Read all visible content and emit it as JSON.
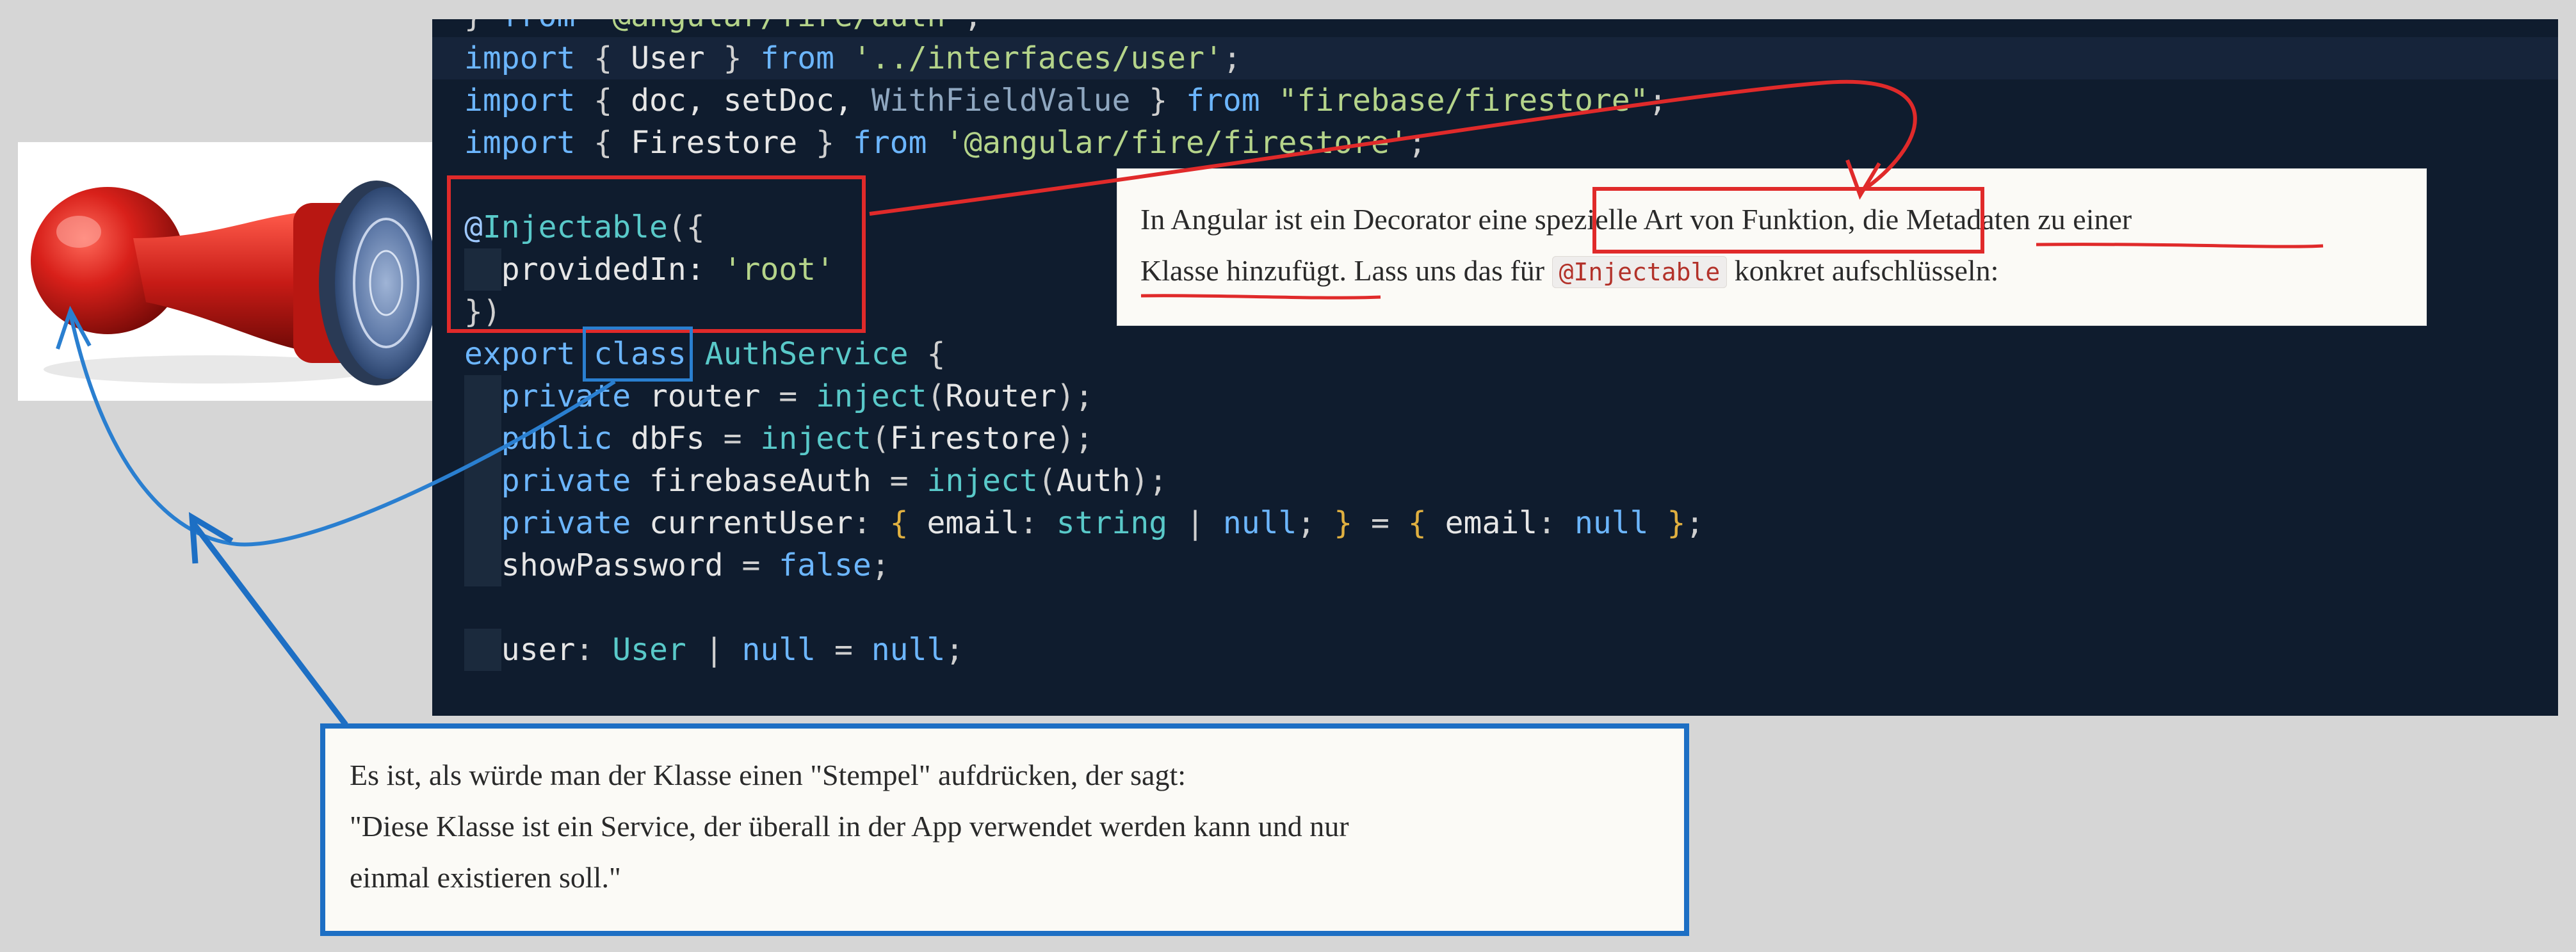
{
  "editor": {
    "lines": [
      {
        "id": "top-cut",
        "parts": [
          [
            "pun",
            "} "
          ],
          [
            "kw",
            "from "
          ],
          [
            "str",
            "\"@angular/fire/auth\""
          ],
          [
            "pun",
            ";"
          ]
        ]
      },
      {
        "id": "import-user",
        "parts": [
          [
            "kw",
            "import "
          ],
          [
            "pun",
            "{ "
          ],
          [
            "",
            "User "
          ],
          [
            "pun",
            "} "
          ],
          [
            "kw",
            "from "
          ],
          [
            "str",
            "'../interfaces/user'"
          ],
          [
            "pun",
            ";"
          ]
        ]
      },
      {
        "id": "import-firestore-fns",
        "parts": [
          [
            "kw",
            "import "
          ],
          [
            "pun",
            "{ "
          ],
          [
            "",
            "doc, setDoc, "
          ],
          [
            "dim",
            "WithFieldValue "
          ],
          [
            "pun",
            "} "
          ],
          [
            "kw",
            "from "
          ],
          [
            "str",
            "\"firebase/firestore\""
          ],
          [
            "pun",
            ";"
          ]
        ]
      },
      {
        "id": "import-firestore",
        "parts": [
          [
            "kw",
            "import "
          ],
          [
            "pun",
            "{ "
          ],
          [
            "",
            "Firestore "
          ],
          [
            "pun",
            "} "
          ],
          [
            "kw",
            "from "
          ],
          [
            "str",
            "'@angular/fire/firestore'"
          ],
          [
            "pun",
            ";"
          ]
        ]
      },
      {
        "id": "blank-1",
        "parts": []
      },
      {
        "id": "decorator-open",
        "parts": [
          [
            "dec",
            "@"
          ],
          [
            "typ",
            "Injectable"
          ],
          [
            "pun",
            "({"
          ]
        ]
      },
      {
        "id": "provided-in",
        "parts": [
          [
            "",
            "  providedIn: "
          ],
          [
            "str",
            "'root'"
          ]
        ]
      },
      {
        "id": "decorator-close",
        "parts": [
          [
            "pun",
            "})"
          ]
        ]
      },
      {
        "id": "class-decl",
        "parts": [
          [
            "kw",
            "export "
          ],
          [
            "kw",
            "class "
          ],
          [
            "typ",
            "AuthService "
          ],
          [
            "pun",
            "{"
          ]
        ]
      },
      {
        "id": "router-field",
        "parts": [
          [
            "kw",
            "  private "
          ],
          [
            "",
            "router "
          ],
          [
            "pun",
            "= "
          ],
          [
            "typ",
            "inject"
          ],
          [
            "pun",
            "("
          ],
          [
            "",
            "Router"
          ],
          [
            "pun",
            ");"
          ]
        ]
      },
      {
        "id": "dbfs-field",
        "parts": [
          [
            "kw",
            "  public "
          ],
          [
            "",
            "dbFs "
          ],
          [
            "pun",
            "= "
          ],
          [
            "typ",
            "inject"
          ],
          [
            "pun",
            "("
          ],
          [
            "",
            "Firestore"
          ],
          [
            "pun",
            ");"
          ]
        ]
      },
      {
        "id": "auth-field",
        "parts": [
          [
            "kw",
            "  private "
          ],
          [
            "",
            "firebaseAuth "
          ],
          [
            "pun",
            "= "
          ],
          [
            "typ",
            "inject"
          ],
          [
            "pun",
            "("
          ],
          [
            "",
            "Auth"
          ],
          [
            "pun",
            ");"
          ]
        ]
      },
      {
        "id": "current-user-field",
        "parts": [
          [
            "kw",
            "  private "
          ],
          [
            "",
            "currentUser"
          ],
          [
            "pun",
            ": "
          ],
          [
            "brace",
            "{ "
          ],
          [
            "",
            "email"
          ],
          [
            "pun",
            ": "
          ],
          [
            "typ",
            "string "
          ],
          [
            "pun",
            "| "
          ],
          [
            "kw",
            "null"
          ],
          [
            "pun",
            "; "
          ],
          [
            "brace",
            "} "
          ],
          [
            "pun",
            "= "
          ],
          [
            "brace",
            "{ "
          ],
          [
            "",
            "email"
          ],
          [
            "pun",
            ": "
          ],
          [
            "kw",
            "null "
          ],
          [
            "brace",
            "}"
          ],
          [
            "pun",
            ";"
          ]
        ]
      },
      {
        "id": "show-password",
        "parts": [
          [
            "",
            "  showPassword "
          ],
          [
            "pun",
            "= "
          ],
          [
            "kw",
            "false"
          ],
          [
            "pun",
            ";"
          ]
        ]
      },
      {
        "id": "blank-2",
        "parts": []
      },
      {
        "id": "user-field",
        "parts": [
          [
            "",
            "  user"
          ],
          [
            "pun",
            ": "
          ],
          [
            "typ",
            "User "
          ],
          [
            "pun",
            "| "
          ],
          [
            "kw",
            "null "
          ],
          [
            "pun",
            "= "
          ],
          [
            "kw",
            "null"
          ],
          [
            "pun",
            ";"
          ]
        ]
      }
    ]
  },
  "callout_decorator": {
    "line1_before": "In Angular ist ein Decorator eine ",
    "line1_boxed": "spezielle Art von Funktion,",
    "line1_middle": " die ",
    "line1_underlined": "Metadaten zu einer",
    "line2_underlined": "Klasse hinzufügt",
    "line2_after_underline": ". Lass uns das für ",
    "line2_code": "@Injectable",
    "line2_end": " konkret aufschlüsseln:"
  },
  "callout_stamp": {
    "line1": "Es ist, als würde man der Klasse einen \"Stempel\" aufdrücken, der sagt:",
    "line2": "\"Diese Klasse ist ein Service, der überall in der App verwendet werden kann und nur",
    "line3": "einmal existieren soll.\""
  },
  "colors": {
    "editor_bg": "#0f1c2e",
    "annotation_red": "#e02a2a",
    "annotation_blue": "#2a7fd0",
    "callout_border_blue": "#1d6fc4"
  },
  "icons": {
    "stamp": "rubber-stamp-photo"
  }
}
